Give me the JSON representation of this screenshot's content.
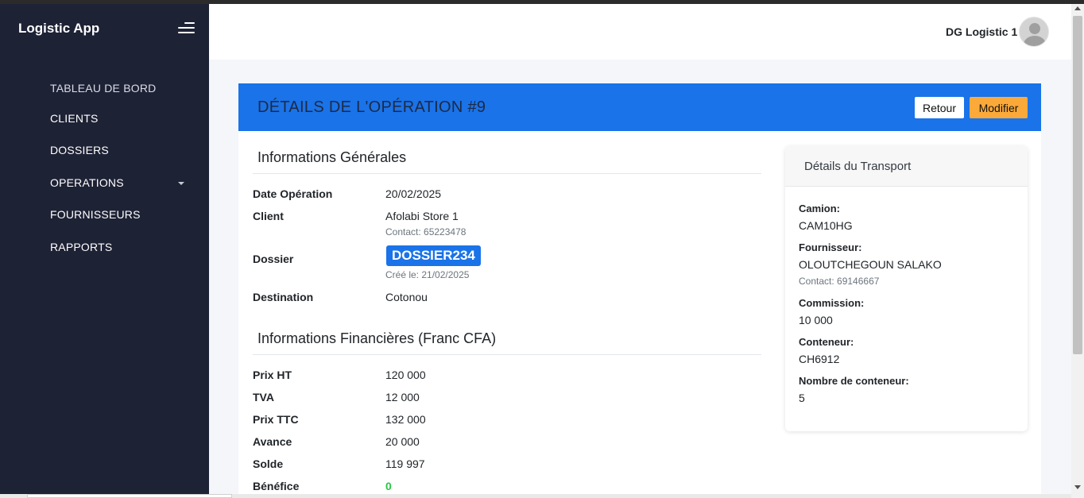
{
  "app": {
    "title": "Logistic App"
  },
  "sidebar": {
    "items": [
      {
        "label": "TABLEAU DE BORD"
      },
      {
        "label": "CLIENTS"
      },
      {
        "label": "DOSSIERS"
      },
      {
        "label": "OPERATIONS"
      },
      {
        "label": "FOURNISSEURS"
      },
      {
        "label": "RAPPORTS"
      }
    ]
  },
  "header": {
    "username": "DG Logistic 1"
  },
  "page": {
    "title": "DÉTAILS DE L'OPÉRATION #9",
    "buttons": {
      "back": "Retour",
      "edit": "Modifier"
    }
  },
  "general": {
    "title": "Informations Générales",
    "date_label": "Date Opération",
    "date_value": "20/02/2025",
    "client_label": "Client",
    "client_value": "Afolabi Store 1",
    "client_contact": "Contact: 65223478",
    "dossier_label": "Dossier",
    "dossier_value": "DOSSIER234",
    "dossier_created": "Créé le: 21/02/2025",
    "destination_label": "Destination",
    "destination_value": "Cotonou"
  },
  "financial": {
    "title": "Informations Financières (Franc CFA)",
    "rows": [
      {
        "label": "Prix HT",
        "value": "120 000"
      },
      {
        "label": "TVA",
        "value": "12 000"
      },
      {
        "label": "Prix TTC",
        "value": "132 000"
      },
      {
        "label": "Avance",
        "value": "20 000"
      },
      {
        "label": "Solde",
        "value": "119 997"
      },
      {
        "label": "Bénéfice",
        "value": "0"
      }
    ]
  },
  "transport": {
    "title": "Détails du Transport",
    "camion_label": "Camion:",
    "camion_value": "CAM10HG",
    "fournisseur_label": "Fournisseur:",
    "fournisseur_value": "OLOUTCHEGOUN SALAKO",
    "fournisseur_contact": "Contact: 69146667",
    "commission_label": "Commission:",
    "commission_value": "10 000",
    "conteneur_label": "Conteneur:",
    "conteneur_value": "CH6912",
    "nb_conteneur_label": "Nombre de conteneur:",
    "nb_conteneur_value": "5"
  },
  "colors": {
    "sidebar_bg": "#1e2235",
    "header_accent": "#1a73e8",
    "edit_button": "#fbaa3a",
    "profit_green": "#28c840"
  },
  "icons": [
    "menu-icon",
    "dropdown-caret-icon",
    "user-avatar-icon"
  ]
}
